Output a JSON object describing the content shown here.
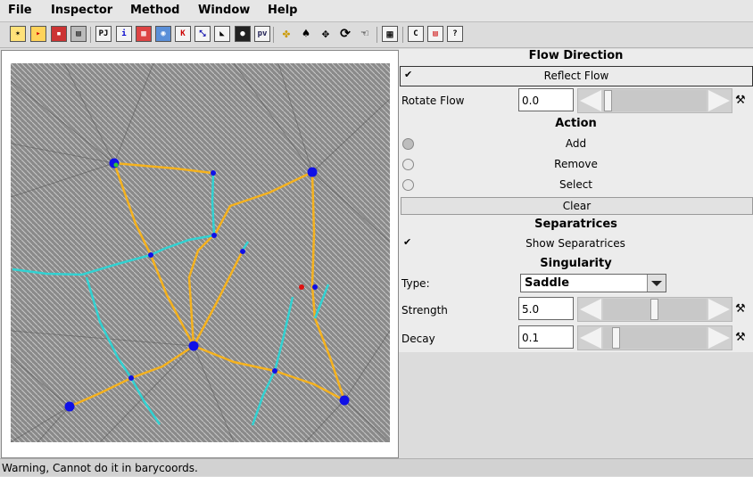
{
  "menu": [
    "File",
    "Inspector",
    "Method",
    "Window",
    "Help"
  ],
  "toolbar": {
    "icons": [
      "new-icon",
      "open-icon",
      "save-icon",
      "print-icon",
      "pj-icon",
      "info-icon",
      "brick-icon",
      "globe-icon",
      "tk-icon",
      "zoom-icon",
      "sheet-icon",
      "camera-icon",
      "pv-icon",
      "flow-icon",
      "tree-icon",
      "move-icon",
      "rotate-icon",
      "hand-icon",
      "grid-icon",
      "c-icon",
      "panel-icon",
      "help-icon"
    ],
    "labels": {
      "pj": "PJ",
      "i": "i",
      "tk": "K",
      "pv": "pv",
      "c": "C"
    }
  },
  "panel": {
    "flow_direction_title": "Flow Direction",
    "reflect_flow_label": "Reflect Flow",
    "reflect_flow_checked": true,
    "rotate_flow_label": "Rotate Flow",
    "rotate_flow_value": "0.0",
    "action_title": "Action",
    "actions": [
      "Add",
      "Remove",
      "Select"
    ],
    "selected_action": "Add",
    "clear_label": "Clear",
    "separatrices_title": "Separatrices",
    "show_separatrices_label": "Show Separatrices",
    "show_separatrices_checked": true,
    "singularity_title": "Singularity",
    "type_label": "Type:",
    "type_value": "Saddle",
    "strength_label": "Strength",
    "strength_value": "5.0",
    "decay_label": "Decay",
    "decay_value": "0.1"
  },
  "colors": {
    "separatrix": "#f5b21e",
    "streamline": "#32d2d2",
    "node": "#1010e6"
  },
  "status": "Warning, Cannot do it in barycoords."
}
